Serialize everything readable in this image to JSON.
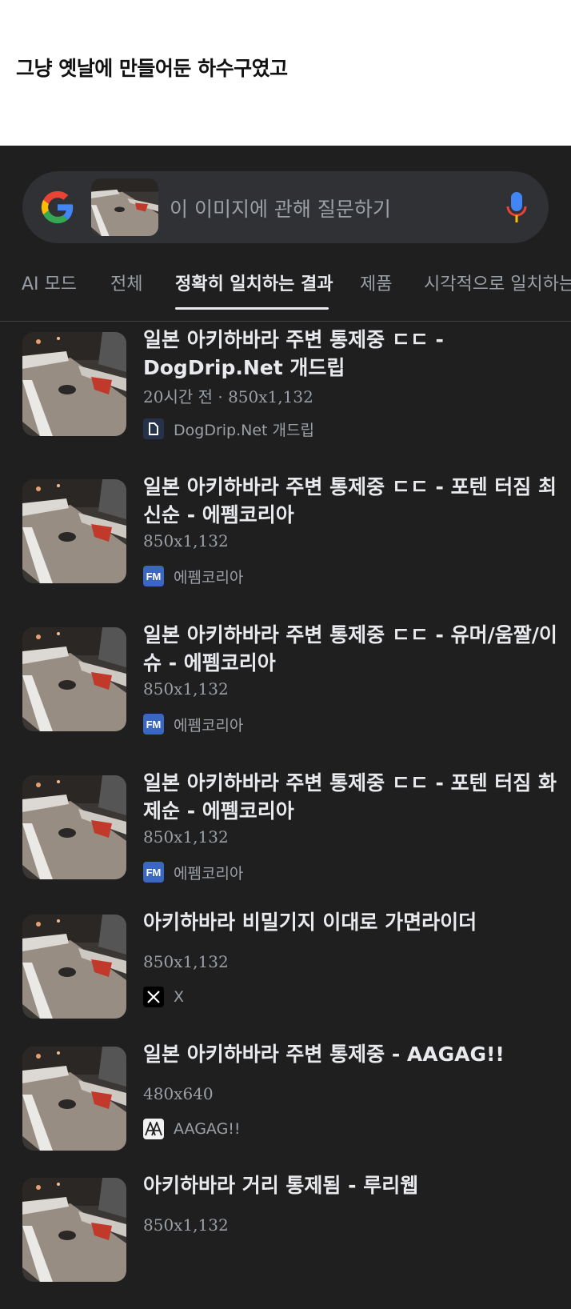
{
  "caption": "그냥 옛날에 만들어둔 하수구였고",
  "search": {
    "placeholder": "이 이미지에 관해 질문하기",
    "google_icon": "google-g-icon",
    "mic_icon": "microphone-icon"
  },
  "tabs": [
    {
      "label": "AI 모드",
      "active": false
    },
    {
      "label": "전체",
      "active": false
    },
    {
      "label": "정확히 일치하는 결과",
      "active": true
    },
    {
      "label": "제품",
      "active": false
    },
    {
      "label": "시각적으로 일치하는",
      "active": false
    }
  ],
  "results": [
    {
      "title": "일본 아키하바라 주변 통제중 ㄷㄷ - DogDrip.Net 개드립",
      "meta": "20시간 전 · 850x1,132",
      "source": "DogDrip.Net 개드립",
      "favicon": "document-icon"
    },
    {
      "title": "일본 아키하바라 주변 통제중 ㄷㄷ - 포텐 터짐 최신순 - 에펨코리아",
      "meta": "850x1,132",
      "source": "에펨코리아",
      "favicon_text": "FM"
    },
    {
      "title": "일본 아키하바라 주변 통제중 ㄷㄷ - 유머/움짤/이슈 - 에펨코리아",
      "meta": "850x1,132",
      "source": "에펨코리아",
      "favicon_text": "FM"
    },
    {
      "title": "일본 아키하바라 주변 통제중 ㄷㄷ - 포텐 터짐 화제순 - 에펨코리아",
      "meta": "850x1,132",
      "source": "에펨코리아",
      "favicon_text": "FM"
    },
    {
      "title": "아키하바라 비밀기지 이대로 가면라이더",
      "meta": "850x1,132",
      "source": "X",
      "favicon": "x-logo-icon"
    },
    {
      "title": "일본 아키하바라 주변 통제중 - AAGAG!!",
      "meta": "480x640",
      "source": "AAGAG!!",
      "favicon": "aagag-logo-icon"
    },
    {
      "title": "아키하바라 거리 통제됨 - 루리웹",
      "meta": "850x1,132",
      "source": "",
      "favicon": ""
    }
  ],
  "colors": {
    "background": "#1f1f1f",
    "search_bg": "#303134",
    "text_primary": "#e8eaed",
    "text_secondary": "#9aa0a6"
  }
}
